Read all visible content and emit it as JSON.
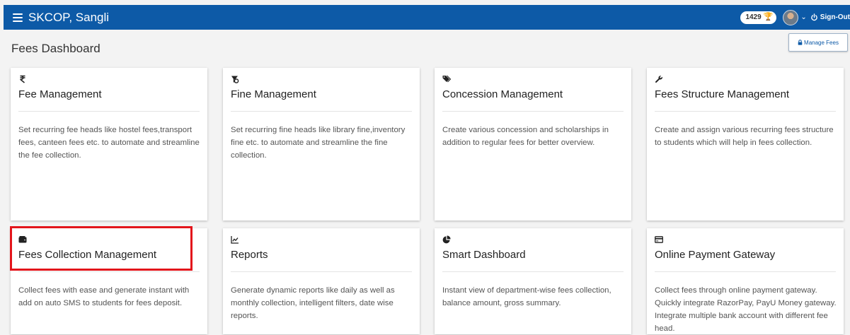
{
  "header": {
    "app_title": "SKCOP, Sangli",
    "points": "1429",
    "signout_label": "Sign-Out",
    "bar_color": "#0d5aa7"
  },
  "page": {
    "title": "Fees Dashboard",
    "manage_fees_label": "Manage Fees"
  },
  "cards": [
    {
      "icon": "rupee-icon",
      "title": "Fee Management",
      "description": "Set recurring fee heads like hostel fees,transport fees, canteen fees etc. to automate and streamline the fee collection."
    },
    {
      "icon": "fine-icon",
      "title": "Fine Management",
      "description": "Set recurring fine heads like library fine,inventory fine etc. to automate and streamline the fine collection."
    },
    {
      "icon": "tags-icon",
      "title": "Concession Management",
      "description": "Create various concession and scholarships in addition to regular fees for better overview."
    },
    {
      "icon": "wrench-icon",
      "title": "Fees Structure Management",
      "description": "Create and assign various recurring fees structure to students which will help in fees collection."
    },
    {
      "icon": "wallet-icon",
      "title": "Fees Collection Management",
      "description": "Collect fees with ease and generate instant with add on auto SMS to students for fees deposit.",
      "highlighted": true
    },
    {
      "icon": "line-chart-icon",
      "title": "Reports",
      "description": "Generate dynamic reports like daily as well as monthly collection, intelligent filters, date wise reports."
    },
    {
      "icon": "pie-chart-icon",
      "title": "Smart Dashboard",
      "description": "Instant view of department-wise fees collection, balance amount, gross summary."
    },
    {
      "icon": "credit-card-icon",
      "title": "Online Payment Gateway",
      "description": "Collect fees through online payment gateway. Quickly integrate RazorPay, PayU Money gateway. Integrate multiple bank account with different fee head."
    }
  ],
  "highlight_color": "#e3151b"
}
